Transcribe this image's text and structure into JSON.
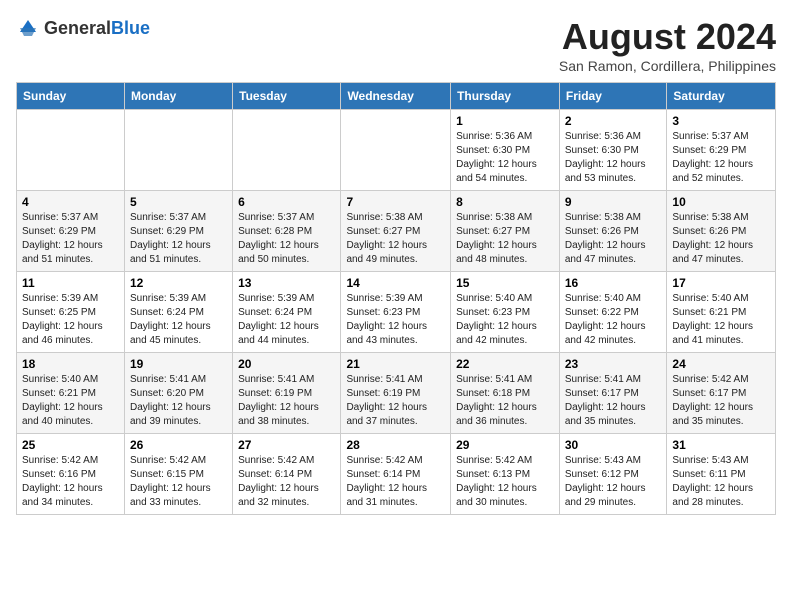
{
  "header": {
    "logo_general": "General",
    "logo_blue": "Blue",
    "month_year": "August 2024",
    "location": "San Ramon, Cordillera, Philippines"
  },
  "days_of_week": [
    "Sunday",
    "Monday",
    "Tuesday",
    "Wednesday",
    "Thursday",
    "Friday",
    "Saturday"
  ],
  "weeks": [
    [
      {
        "day": "",
        "info": ""
      },
      {
        "day": "",
        "info": ""
      },
      {
        "day": "",
        "info": ""
      },
      {
        "day": "",
        "info": ""
      },
      {
        "day": "1",
        "info": "Sunrise: 5:36 AM\nSunset: 6:30 PM\nDaylight: 12 hours\nand 54 minutes."
      },
      {
        "day": "2",
        "info": "Sunrise: 5:36 AM\nSunset: 6:30 PM\nDaylight: 12 hours\nand 53 minutes."
      },
      {
        "day": "3",
        "info": "Sunrise: 5:37 AM\nSunset: 6:29 PM\nDaylight: 12 hours\nand 52 minutes."
      }
    ],
    [
      {
        "day": "4",
        "info": "Sunrise: 5:37 AM\nSunset: 6:29 PM\nDaylight: 12 hours\nand 51 minutes."
      },
      {
        "day": "5",
        "info": "Sunrise: 5:37 AM\nSunset: 6:29 PM\nDaylight: 12 hours\nand 51 minutes."
      },
      {
        "day": "6",
        "info": "Sunrise: 5:37 AM\nSunset: 6:28 PM\nDaylight: 12 hours\nand 50 minutes."
      },
      {
        "day": "7",
        "info": "Sunrise: 5:38 AM\nSunset: 6:27 PM\nDaylight: 12 hours\nand 49 minutes."
      },
      {
        "day": "8",
        "info": "Sunrise: 5:38 AM\nSunset: 6:27 PM\nDaylight: 12 hours\nand 48 minutes."
      },
      {
        "day": "9",
        "info": "Sunrise: 5:38 AM\nSunset: 6:26 PM\nDaylight: 12 hours\nand 47 minutes."
      },
      {
        "day": "10",
        "info": "Sunrise: 5:38 AM\nSunset: 6:26 PM\nDaylight: 12 hours\nand 47 minutes."
      }
    ],
    [
      {
        "day": "11",
        "info": "Sunrise: 5:39 AM\nSunset: 6:25 PM\nDaylight: 12 hours\nand 46 minutes."
      },
      {
        "day": "12",
        "info": "Sunrise: 5:39 AM\nSunset: 6:24 PM\nDaylight: 12 hours\nand 45 minutes."
      },
      {
        "day": "13",
        "info": "Sunrise: 5:39 AM\nSunset: 6:24 PM\nDaylight: 12 hours\nand 44 minutes."
      },
      {
        "day": "14",
        "info": "Sunrise: 5:39 AM\nSunset: 6:23 PM\nDaylight: 12 hours\nand 43 minutes."
      },
      {
        "day": "15",
        "info": "Sunrise: 5:40 AM\nSunset: 6:23 PM\nDaylight: 12 hours\nand 42 minutes."
      },
      {
        "day": "16",
        "info": "Sunrise: 5:40 AM\nSunset: 6:22 PM\nDaylight: 12 hours\nand 42 minutes."
      },
      {
        "day": "17",
        "info": "Sunrise: 5:40 AM\nSunset: 6:21 PM\nDaylight: 12 hours\nand 41 minutes."
      }
    ],
    [
      {
        "day": "18",
        "info": "Sunrise: 5:40 AM\nSunset: 6:21 PM\nDaylight: 12 hours\nand 40 minutes."
      },
      {
        "day": "19",
        "info": "Sunrise: 5:41 AM\nSunset: 6:20 PM\nDaylight: 12 hours\nand 39 minutes."
      },
      {
        "day": "20",
        "info": "Sunrise: 5:41 AM\nSunset: 6:19 PM\nDaylight: 12 hours\nand 38 minutes."
      },
      {
        "day": "21",
        "info": "Sunrise: 5:41 AM\nSunset: 6:19 PM\nDaylight: 12 hours\nand 37 minutes."
      },
      {
        "day": "22",
        "info": "Sunrise: 5:41 AM\nSunset: 6:18 PM\nDaylight: 12 hours\nand 36 minutes."
      },
      {
        "day": "23",
        "info": "Sunrise: 5:41 AM\nSunset: 6:17 PM\nDaylight: 12 hours\nand 35 minutes."
      },
      {
        "day": "24",
        "info": "Sunrise: 5:42 AM\nSunset: 6:17 PM\nDaylight: 12 hours\nand 35 minutes."
      }
    ],
    [
      {
        "day": "25",
        "info": "Sunrise: 5:42 AM\nSunset: 6:16 PM\nDaylight: 12 hours\nand 34 minutes."
      },
      {
        "day": "26",
        "info": "Sunrise: 5:42 AM\nSunset: 6:15 PM\nDaylight: 12 hours\nand 33 minutes."
      },
      {
        "day": "27",
        "info": "Sunrise: 5:42 AM\nSunset: 6:14 PM\nDaylight: 12 hours\nand 32 minutes."
      },
      {
        "day": "28",
        "info": "Sunrise: 5:42 AM\nSunset: 6:14 PM\nDaylight: 12 hours\nand 31 minutes."
      },
      {
        "day": "29",
        "info": "Sunrise: 5:42 AM\nSunset: 6:13 PM\nDaylight: 12 hours\nand 30 minutes."
      },
      {
        "day": "30",
        "info": "Sunrise: 5:43 AM\nSunset: 6:12 PM\nDaylight: 12 hours\nand 29 minutes."
      },
      {
        "day": "31",
        "info": "Sunrise: 5:43 AM\nSunset: 6:11 PM\nDaylight: 12 hours\nand 28 minutes."
      }
    ]
  ]
}
